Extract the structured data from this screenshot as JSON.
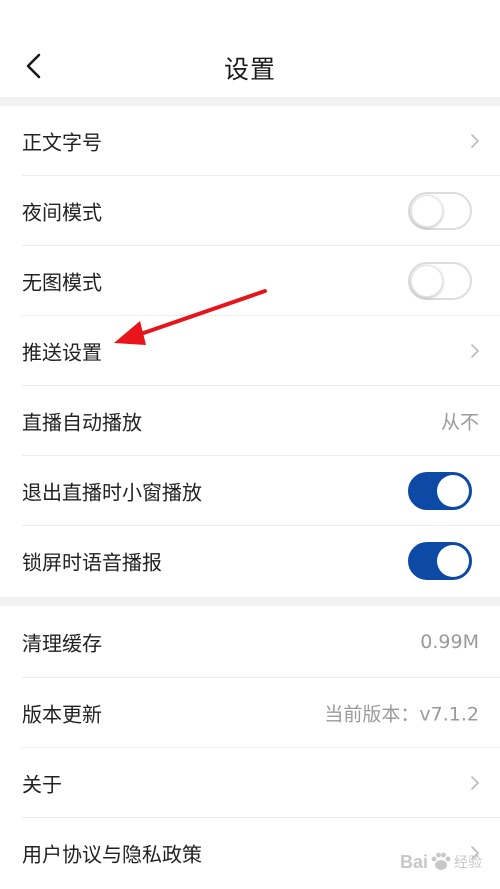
{
  "header": {
    "title": "设置"
  },
  "settings_group_1": {
    "items": [
      {
        "label": "正文字号"
      },
      {
        "label": "夜间模式",
        "toggle_on": false
      },
      {
        "label": "无图模式",
        "toggle_on": false
      },
      {
        "label": "推送设置"
      },
      {
        "label": "直播自动播放",
        "value": "从不"
      },
      {
        "label": "退出直播时小窗播放",
        "toggle_on": true
      },
      {
        "label": "锁屏时语音播报",
        "toggle_on": true
      }
    ]
  },
  "settings_group_2": {
    "items": [
      {
        "label": "清理缓存",
        "value": "0.99M"
      },
      {
        "label": "版本更新",
        "value": "当前版本：v7.1.2"
      },
      {
        "label": "关于"
      },
      {
        "label": "用户协议与隐私政策"
      }
    ]
  },
  "watermark": {
    "brand_text_left": "Bai",
    "brand_text_right": "经验"
  },
  "colors": {
    "toggle_on": "#0c4aa6",
    "annotation_arrow": "#e8141b",
    "divider": "#f2f2f2"
  }
}
